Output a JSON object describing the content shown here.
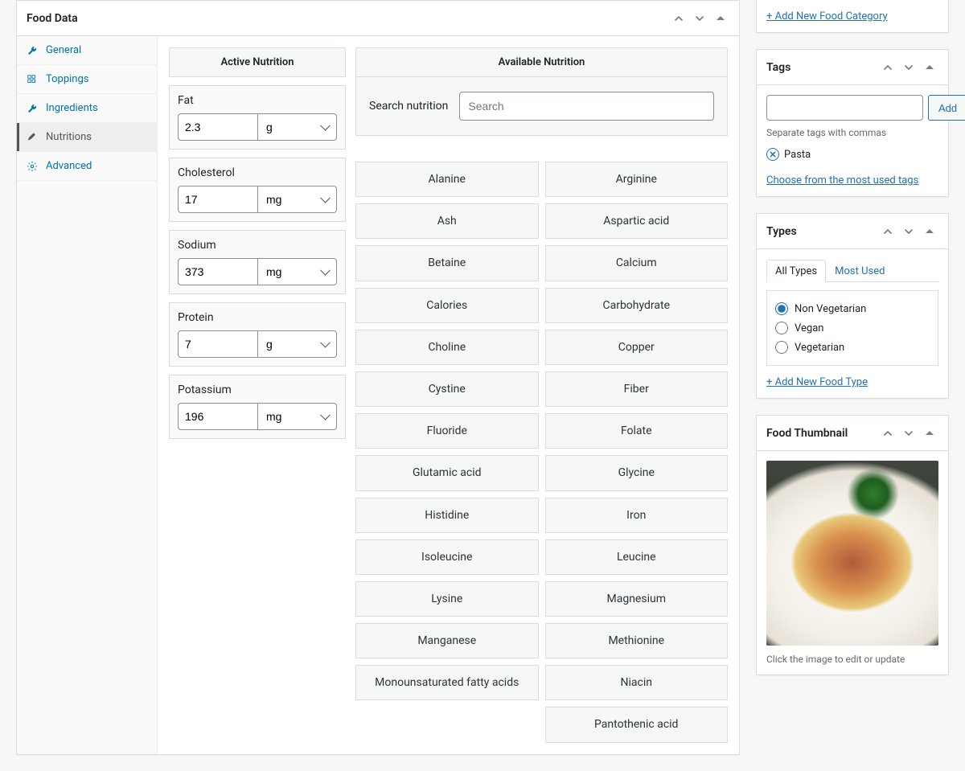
{
  "main_panel": {
    "title": "Food Data",
    "nav": [
      {
        "label": "General",
        "icon": "wrench",
        "active": false
      },
      {
        "label": "Toppings",
        "icon": "grid",
        "active": false
      },
      {
        "label": "Ingredients",
        "icon": "wrench",
        "active": false
      },
      {
        "label": "Nutritions",
        "icon": "pencil",
        "active": true
      },
      {
        "label": "Advanced",
        "icon": "gear",
        "active": false
      }
    ],
    "active_nutrition": {
      "heading": "Active Nutrition",
      "items": [
        {
          "label": "Fat",
          "value": "2.3",
          "unit": "g"
        },
        {
          "label": "Cholesterol",
          "value": "17",
          "unit": "mg"
        },
        {
          "label": "Sodium",
          "value": "373",
          "unit": "mg"
        },
        {
          "label": "Protein",
          "value": "7",
          "unit": "g"
        },
        {
          "label": "Potassium",
          "value": "196",
          "unit": "mg"
        }
      ]
    },
    "available_nutrition": {
      "heading": "Available Nutrition",
      "search_label": "Search nutrition",
      "search_placeholder": "Search",
      "items": [
        "Alanine",
        "Arginine",
        "Ash",
        "Aspartic acid",
        "Betaine",
        "Calcium",
        "Calories",
        "Carbohydrate",
        "Choline",
        "Copper",
        "Cystine",
        "Fiber",
        "Fluoride",
        "Folate",
        "Glutamic acid",
        "Glycine",
        "Histidine",
        "Iron",
        "Isoleucine",
        "Leucine",
        "Lysine",
        "Magnesium",
        "Manganese",
        "Methionine",
        "Monounsaturated fatty acids",
        "Niacin",
        "",
        "Pantothenic acid"
      ]
    }
  },
  "categories": {
    "add_link": "+ Add New Food Category"
  },
  "tags": {
    "title": "Tags",
    "add_button": "Add",
    "help": "Separate tags with commas",
    "chips": [
      "Pasta"
    ],
    "most_used_link": "Choose from the most used tags"
  },
  "types": {
    "title": "Types",
    "tabs": [
      "All Types",
      "Most Used"
    ],
    "active_tab": 0,
    "options": [
      {
        "label": "Non Vegetarian",
        "checked": true
      },
      {
        "label": "Vegan",
        "checked": false
      },
      {
        "label": "Vegetarian",
        "checked": false
      }
    ],
    "add_link": "+ Add New Food Type"
  },
  "thumbnail": {
    "title": "Food Thumbnail",
    "caption": "Click the image to edit or update"
  }
}
